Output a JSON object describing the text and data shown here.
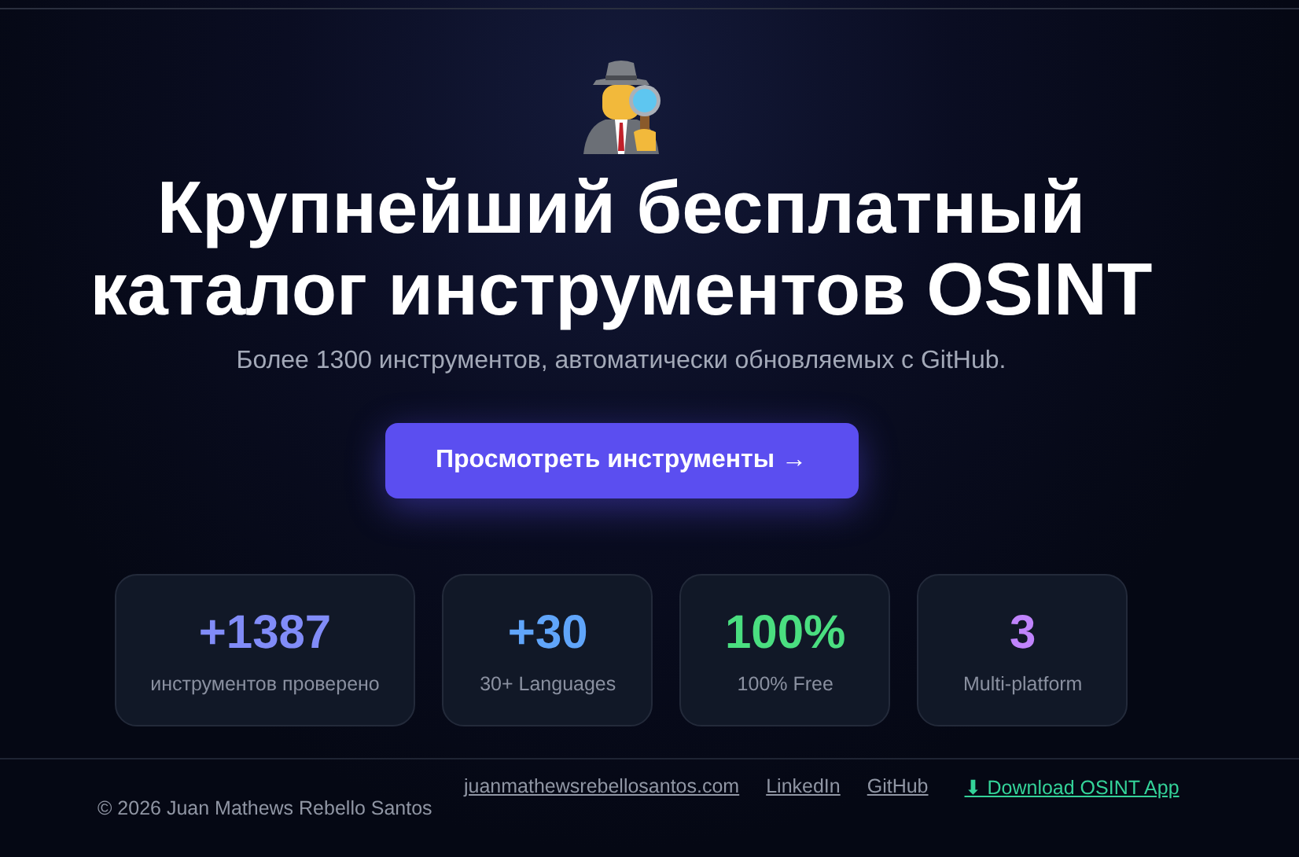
{
  "hero": {
    "title_lines": [
      "Крупнейший бесплатный",
      "каталог инструментов OSINT"
    ],
    "subtitle": "Более 1300 инструментов, автоматически обновляемых с GitHub.",
    "button": "Просмотреть инструменты →"
  },
  "stats": [
    {
      "value": "+1387",
      "label": "инструментов проверено",
      "color": "#818cf8"
    },
    {
      "value": "+30",
      "label": "30+ Languages",
      "color": "#60a5fa"
    },
    {
      "value": "100%",
      "label": "100% Free",
      "color": "#4ade80"
    },
    {
      "value": "3",
      "label": "Multi-platform",
      "color": "#c084fc"
    }
  ],
  "footer": {
    "copyright": "© 2026 Juan Mathews Rebello Santos",
    "links": [
      {
        "label": "juanmathewsrebellosantos.com",
        "kind": "plain"
      },
      {
        "label": "LinkedIn",
        "kind": "plain"
      },
      {
        "label": "GitHub",
        "kind": "plain"
      },
      {
        "label": "⬇ Download OSINT App",
        "kind": "accent"
      }
    ]
  }
}
